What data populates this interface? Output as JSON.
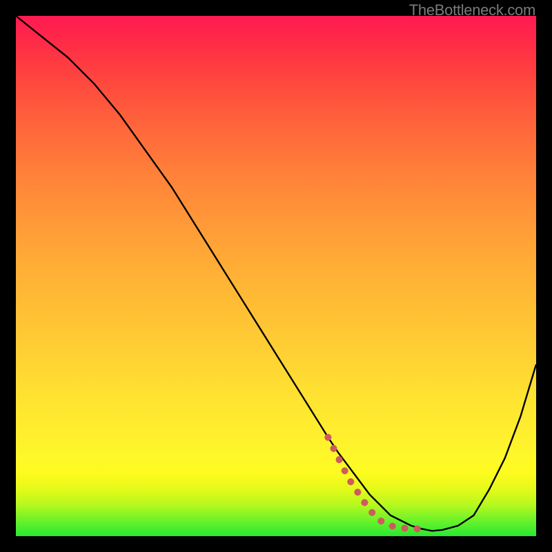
{
  "watermark": "TheBottleneck.com",
  "chart_data": {
    "type": "line",
    "title": "",
    "xlabel": "",
    "ylabel": "",
    "xlim": [
      0,
      100
    ],
    "ylim": [
      0,
      100
    ],
    "grid": false,
    "legend": false,
    "background_gradient": {
      "direction": "vertical",
      "stops": [
        {
          "pos": 0,
          "color": "#27e833"
        },
        {
          "pos": 12,
          "color": "#fdfb1e"
        },
        {
          "pos": 50,
          "color": "#ffb435"
        },
        {
          "pos": 100,
          "color": "#ff1a52"
        }
      ]
    },
    "series": [
      {
        "name": "black-curve",
        "color": "#000000",
        "x": [
          0,
          5,
          10,
          15,
          20,
          25,
          30,
          35,
          40,
          45,
          50,
          55,
          60,
          62,
          65,
          68,
          70,
          72,
          74,
          76,
          78,
          80,
          82,
          85,
          88,
          91,
          94,
          97,
          100
        ],
        "y": [
          100,
          96,
          92,
          87,
          81,
          74,
          67,
          59,
          51,
          43,
          35,
          27,
          19,
          16,
          12,
          8,
          6,
          4,
          3,
          2,
          1.4,
          1,
          1.2,
          2,
          4,
          9,
          15,
          23,
          33
        ]
      },
      {
        "name": "red-dotted-segment",
        "color": "#cd5c5c",
        "style": "dotted",
        "x": [
          60,
          62,
          64,
          66,
          68,
          70,
          72,
          74,
          76,
          78
        ],
        "y": [
          19,
          15,
          11,
          8,
          5,
          3,
          2,
          1.6,
          1.4,
          1.4
        ]
      }
    ]
  }
}
